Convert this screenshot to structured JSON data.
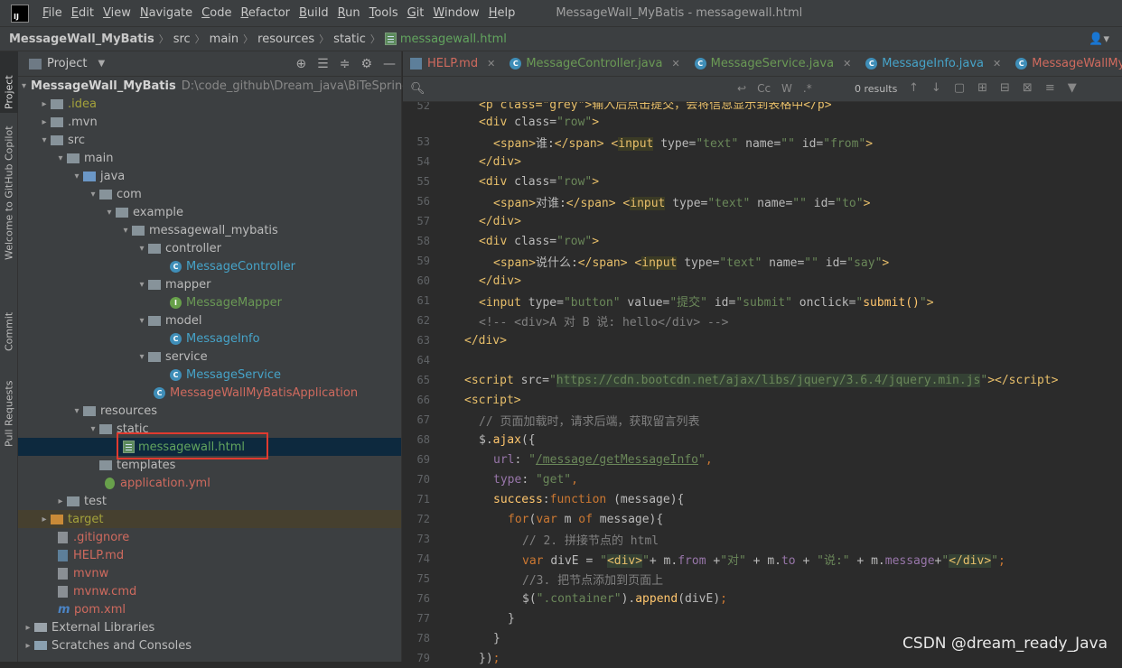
{
  "menubar": {
    "logo": "IJ",
    "items": [
      "File",
      "Edit",
      "View",
      "Navigate",
      "Code",
      "Refactor",
      "Build",
      "Run",
      "Tools",
      "Git",
      "Window",
      "Help"
    ],
    "window_title": "MessageWall_MyBatis - messagewall.html"
  },
  "navbar": {
    "crumbs": [
      "MessageWall_MyBatis",
      "src",
      "main",
      "resources",
      "static",
      "messagewall.html"
    ]
  },
  "left_strip": {
    "tabs": [
      "Project",
      "Welcome to GitHub Copilot",
      "Commit",
      "Pull Requests"
    ]
  },
  "project_panel": {
    "title": "Project",
    "tree": [
      {
        "label": "MessageWall_MyBatis",
        "path": "D:\\code_github\\Dream_java\\BiTeSpringBo"
      },
      {
        "label": ".idea"
      },
      {
        "label": ".mvn"
      },
      {
        "label": "src"
      },
      {
        "label": "main"
      },
      {
        "label": "java"
      },
      {
        "label": "com"
      },
      {
        "label": "example"
      },
      {
        "label": "messagewall_mybatis"
      },
      {
        "label": "controller"
      },
      {
        "label": "MessageController"
      },
      {
        "label": "mapper"
      },
      {
        "label": "MessageMapper"
      },
      {
        "label": "model"
      },
      {
        "label": "MessageInfo"
      },
      {
        "label": "service"
      },
      {
        "label": "MessageService"
      },
      {
        "label": "MessageWallMyBatisApplication"
      },
      {
        "label": "resources"
      },
      {
        "label": "static"
      },
      {
        "label": "messagewall.html"
      },
      {
        "label": "templates"
      },
      {
        "label": "application.yml"
      },
      {
        "label": "test"
      },
      {
        "label": "target"
      },
      {
        "label": ".gitignore"
      },
      {
        "label": "HELP.md"
      },
      {
        "label": "mvnw"
      },
      {
        "label": "mvnw.cmd"
      },
      {
        "label": "pom.xml"
      },
      {
        "label": "External Libraries"
      },
      {
        "label": "Scratches and Consoles"
      }
    ]
  },
  "editor": {
    "tabs": [
      "HELP.md",
      "MessageController.java",
      "MessageService.java",
      "MessageInfo.java",
      "MessageWallMyBatisApplicati"
    ],
    "search": {
      "results": "0 results",
      "cc": "Cc",
      "w": "W",
      "star": ".*"
    },
    "line_numbers": [
      "52",
      "53",
      "54",
      "55",
      "56",
      "57",
      "58",
      "59",
      "60",
      "61",
      "62",
      "63",
      "64",
      "65",
      "66",
      "67",
      "68",
      "69",
      "70",
      "71",
      "72",
      "73",
      "74",
      "75",
      "76",
      "77",
      "78",
      "79"
    ],
    "code": {
      "l52": "<p class=\"grey\">输入后点击提交，会将信息显示到表格中</p>",
      "l53_tag": "span",
      "l53_text": "谁:",
      "l53_input": "input",
      "l53_id": "\"from\"",
      "l56_text": "对谁:",
      "l56_id": "\"to\"",
      "l59_text": "说什么:",
      "l59_id": "\"say\"",
      "l61_value": "\"提交\"",
      "l61_id": "\"submit\"",
      "l61_onclick": "submit()",
      "l62": "<!-- <div>A 对 B 说: hello</div> -->",
      "l65_src": "https://cdn.bootcdn.net/ajax/libs/jquery/3.6.4/jquery.min.js",
      "l67": "// 页面加载时，请求后端，获取留言列表",
      "l69_url": "/message/getMessageInfo",
      "l70_type": "\"get\"",
      "l73": "// 2. 拼接节点的 html",
      "l74_dui": "\"对\"",
      "l74_shuo": "\"说:\"",
      "l75": "//3. 把节点添加到页面上",
      "l76_sel": "\".container\""
    }
  },
  "watermark": "CSDN @dream_ready_Java",
  "colors": {
    "accent": "#e03a2f",
    "selection": "#0d293e",
    "bg": "#2b2b2b"
  }
}
